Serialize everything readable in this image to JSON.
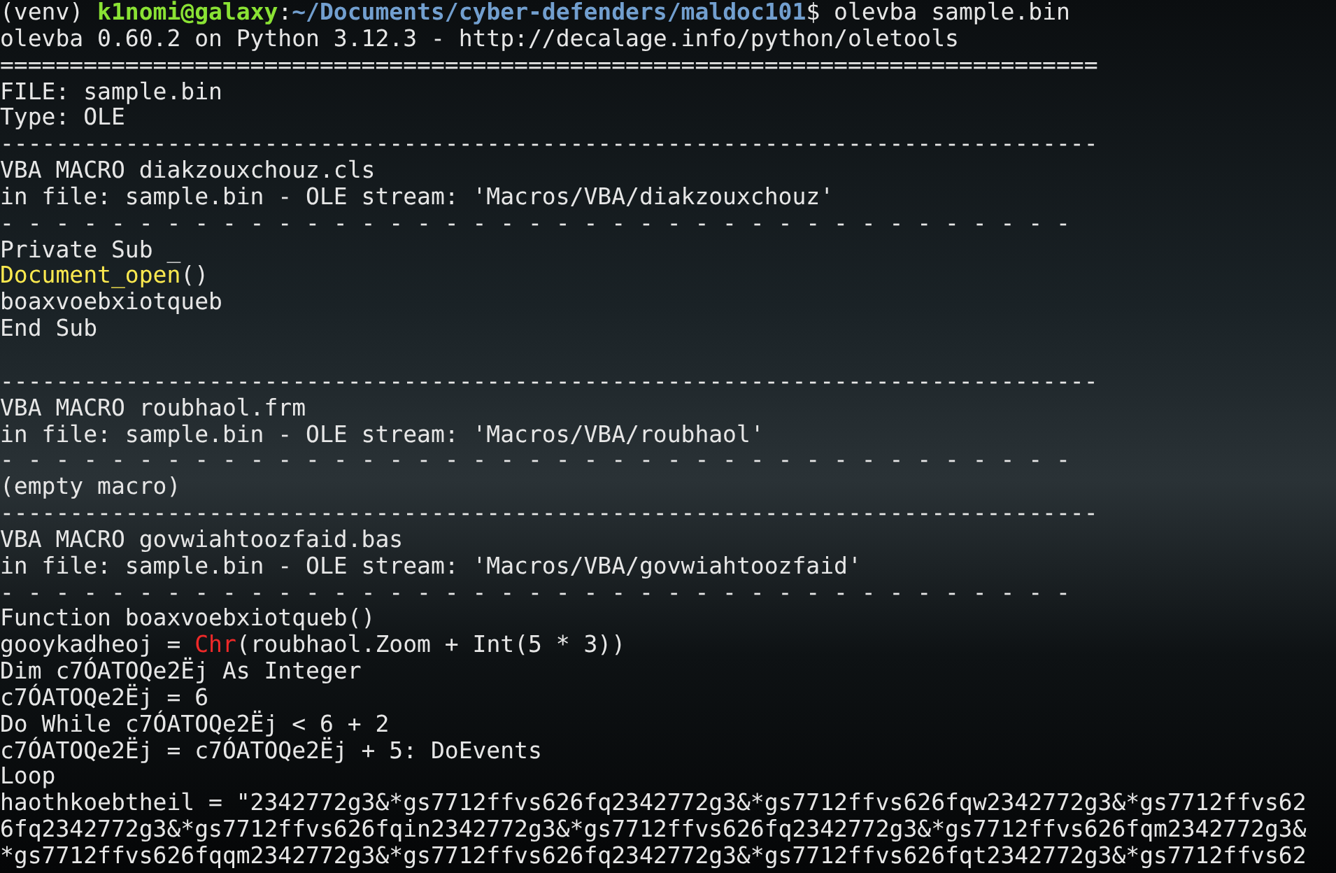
{
  "terminal": {
    "lines": [
      {
        "kind": "text",
        "segments": [
          {
            "kind": "plain",
            "text": "(venv) "
          },
          {
            "kind": "user",
            "text": "k1nomi@galaxy"
          },
          {
            "kind": "plain",
            "text": ":"
          },
          {
            "kind": "path",
            "text": "~/Documents/cyber-defenders/maldoc101"
          },
          {
            "kind": "plain",
            "text": "$ olevba sample.bin"
          }
        ]
      },
      {
        "kind": "text",
        "segments": [
          {
            "kind": "plain",
            "text": "olevba 0.60.2 on Python 3.12.3 - http://decalage.info/python/oletools"
          }
        ]
      },
      {
        "kind": "text",
        "segments": [
          {
            "kind": "plain",
            "text": "==============================================================================="
          }
        ]
      },
      {
        "kind": "text",
        "segments": [
          {
            "kind": "plain",
            "text": "FILE: sample.bin"
          }
        ]
      },
      {
        "kind": "text",
        "segments": [
          {
            "kind": "plain",
            "text": "Type: OLE"
          }
        ]
      },
      {
        "kind": "text",
        "segments": [
          {
            "kind": "plain",
            "text": "-------------------------------------------------------------------------------"
          }
        ]
      },
      {
        "kind": "text",
        "segments": [
          {
            "kind": "plain",
            "text": "VBA MACRO diakzouxchouz.cls"
          }
        ]
      },
      {
        "kind": "text",
        "segments": [
          {
            "kind": "plain",
            "text": "in file: sample.bin - OLE stream: 'Macros/VBA/diakzouxchouz'"
          }
        ]
      },
      {
        "kind": "text",
        "segments": [
          {
            "kind": "plain",
            "text": "- - - - - - - - - - - - - - - - - - - - - - - - - - - - - - - - - - - - - - -"
          }
        ]
      },
      {
        "kind": "text",
        "segments": [
          {
            "kind": "plain",
            "text": "Private Sub _"
          }
        ]
      },
      {
        "kind": "text",
        "segments": [
          {
            "kind": "event",
            "text": "Document_open"
          },
          {
            "kind": "plain",
            "text": "()"
          }
        ]
      },
      {
        "kind": "text",
        "segments": [
          {
            "kind": "plain",
            "text": "boaxvoebxiotqueb"
          }
        ]
      },
      {
        "kind": "text",
        "segments": [
          {
            "kind": "plain",
            "text": "End Sub"
          }
        ]
      },
      {
        "kind": "blank"
      },
      {
        "kind": "text",
        "segments": [
          {
            "kind": "plain",
            "text": "-------------------------------------------------------------------------------"
          }
        ]
      },
      {
        "kind": "text",
        "segments": [
          {
            "kind": "plain",
            "text": "VBA MACRO roubhaol.frm"
          }
        ]
      },
      {
        "kind": "text",
        "segments": [
          {
            "kind": "plain",
            "text": "in file: sample.bin - OLE stream: 'Macros/VBA/roubhaol'"
          }
        ]
      },
      {
        "kind": "text",
        "segments": [
          {
            "kind": "plain",
            "text": "- - - - - - - - - - - - - - - - - - - - - - - - - - - - - - - - - - - - - - -"
          }
        ]
      },
      {
        "kind": "text",
        "segments": [
          {
            "kind": "plain",
            "text": "(empty macro)"
          }
        ]
      },
      {
        "kind": "text",
        "segments": [
          {
            "kind": "plain",
            "text": "-------------------------------------------------------------------------------"
          }
        ]
      },
      {
        "kind": "text",
        "segments": [
          {
            "kind": "plain",
            "text": "VBA MACRO govwiahtoozfaid.bas"
          }
        ]
      },
      {
        "kind": "text",
        "segments": [
          {
            "kind": "plain",
            "text": "in file: sample.bin - OLE stream: 'Macros/VBA/govwiahtoozfaid'"
          }
        ]
      },
      {
        "kind": "text",
        "segments": [
          {
            "kind": "plain",
            "text": "- - - - - - - - - - - - - - - - - - - - - - - - - - - - - - - - - - - - - - -"
          }
        ]
      },
      {
        "kind": "text",
        "segments": [
          {
            "kind": "plain",
            "text": "Function boaxvoebxiotqueb()"
          }
        ]
      },
      {
        "kind": "text",
        "segments": [
          {
            "kind": "plain",
            "text": "gooykadheoj = "
          },
          {
            "kind": "builtin",
            "text": "Chr"
          },
          {
            "kind": "plain",
            "text": "(roubhaol.Zoom + Int(5 * 3))"
          }
        ]
      },
      {
        "kind": "text",
        "segments": [
          {
            "kind": "plain",
            "text": "Dim c7ÓATOQe2Ëj As Integer"
          }
        ]
      },
      {
        "kind": "text",
        "segments": [
          {
            "kind": "plain",
            "text": "c7ÓATOQe2Ëj = 6"
          }
        ]
      },
      {
        "kind": "text",
        "segments": [
          {
            "kind": "plain",
            "text": "Do While c7ÓATOQe2Ëj < 6 + 2"
          }
        ]
      },
      {
        "kind": "text",
        "segments": [
          {
            "kind": "plain",
            "text": "c7ÓATOQe2Ëj = c7ÓATOQe2Ëj + 5: DoEvents"
          }
        ]
      },
      {
        "kind": "text",
        "segments": [
          {
            "kind": "plain",
            "text": "Loop"
          }
        ]
      },
      {
        "kind": "text",
        "segments": [
          {
            "kind": "plain",
            "text": "haothkoebtheil = \"2342772g3&*gs7712ffvs626fq2342772g3&*gs7712ffvs626fqw2342772g3&*gs7712ffvs62"
          }
        ]
      },
      {
        "kind": "text",
        "segments": [
          {
            "kind": "plain",
            "text": "6fq2342772g3&*gs7712ffvs626fqin2342772g3&*gs7712ffvs626fq2342772g3&*gs7712ffvs626fqm2342772g3&"
          }
        ]
      },
      {
        "kind": "text",
        "segments": [
          {
            "kind": "plain",
            "text": "*gs7712ffvs626fqqm2342772g3&*gs7712ffvs626fq2342772g3&*gs7712ffvs626fqt2342772g3&*gs7712ffvs62"
          }
        ]
      }
    ]
  }
}
